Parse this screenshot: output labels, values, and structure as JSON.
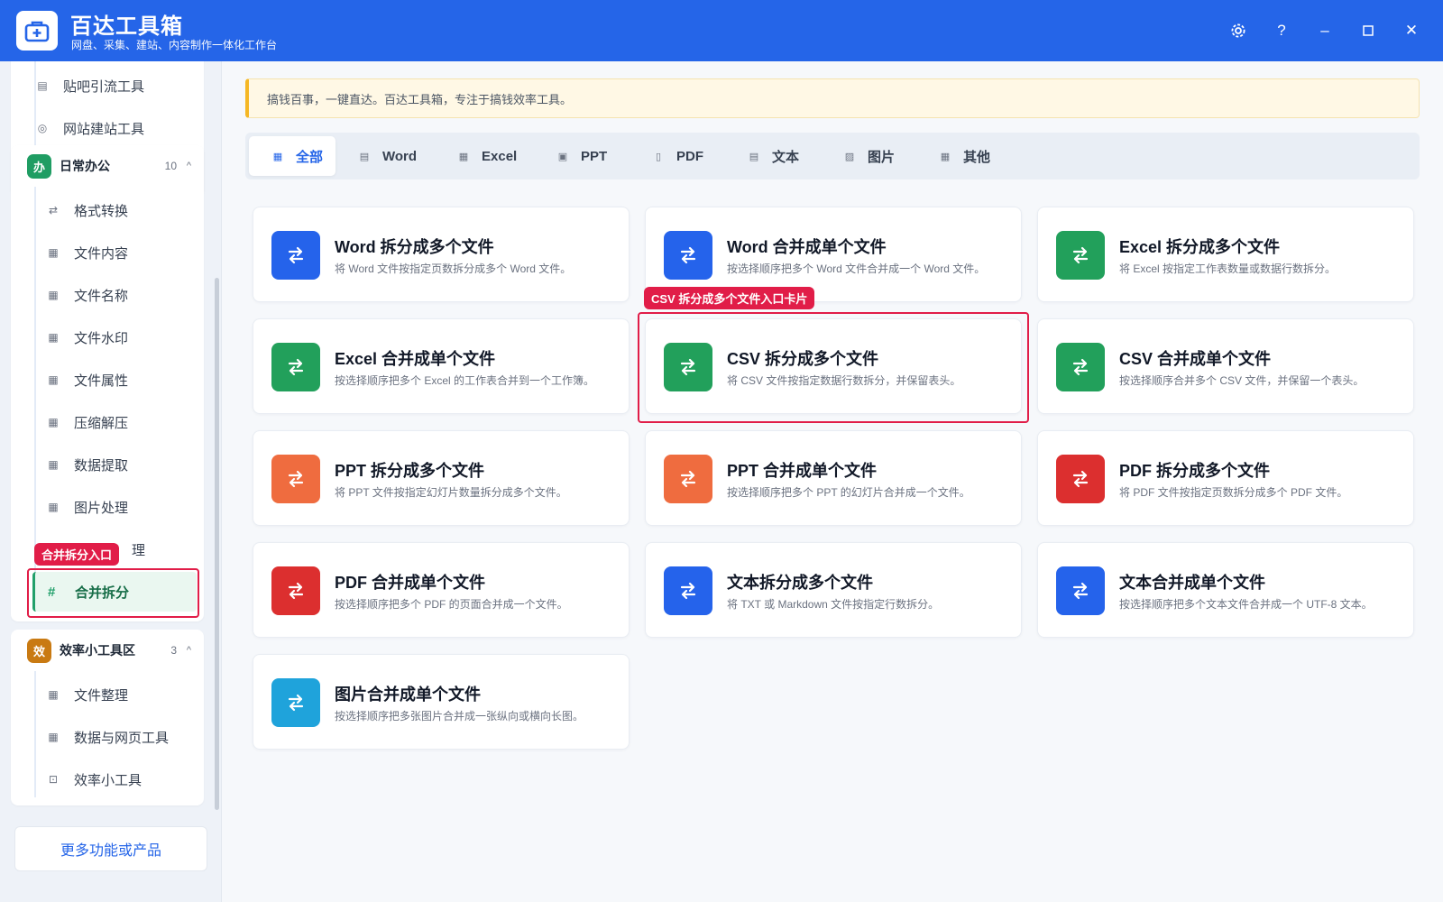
{
  "app": {
    "title": "百达工具箱",
    "subtitle": "网盘、采集、建站、内容制作一体化工作台",
    "logo_icon": "toolbox-icon"
  },
  "window_controls": {
    "settings": "⚙",
    "help": "?",
    "minimize": "–",
    "maximize": "□",
    "close": "✕"
  },
  "sidebar": {
    "top_items": [
      {
        "label": "贴吧引流工具",
        "icon": "list-icon"
      },
      {
        "label": "网站建站工具",
        "icon": "globe-icon"
      }
    ],
    "groups": [
      {
        "badge": "办",
        "title": "日常办公",
        "count": "10",
        "badge_color": "#1f9d63",
        "items": [
          {
            "label": "格式转换",
            "icon": "swap-icon"
          },
          {
            "label": "文件内容",
            "icon": "grid-icon"
          },
          {
            "label": "文件名称",
            "icon": "grid-icon"
          },
          {
            "label": "文件水印",
            "icon": "grid-icon"
          },
          {
            "label": "文件属性",
            "icon": "grid-icon"
          },
          {
            "label": "压缩解压",
            "icon": "grid-icon"
          },
          {
            "label": "数据提取",
            "icon": "grid-icon"
          },
          {
            "label": "图片处理",
            "icon": "grid-icon"
          },
          {
            "label": "理",
            "icon": "grid-icon"
          }
        ],
        "active_item": {
          "label": "合并拆分",
          "icon": "hash-icon"
        }
      },
      {
        "badge": "效",
        "title": "效率小工具区",
        "count": "3",
        "badge_color": "#c97a12",
        "items": [
          {
            "label": "文件整理",
            "icon": "grid-icon"
          },
          {
            "label": "数据与网页工具",
            "icon": "grid-icon"
          },
          {
            "label": "效率小工具",
            "icon": "toolbox-icon"
          }
        ]
      }
    ],
    "more_button": "更多功能或产品",
    "highlight_tag": "合并拆分入口"
  },
  "notice": "搞钱百事，一键直达。百达工具箱，专注于搞钱效率工具。",
  "tabs": [
    {
      "label": "全部",
      "icon": "grid-icon",
      "active": true
    },
    {
      "label": "Word",
      "icon": "doc-icon"
    },
    {
      "label": "Excel",
      "icon": "table-icon"
    },
    {
      "label": "PPT",
      "icon": "slides-icon"
    },
    {
      "label": "PDF",
      "icon": "file-icon"
    },
    {
      "label": "文本",
      "icon": "text-icon"
    },
    {
      "label": "图片",
      "icon": "image-icon"
    },
    {
      "label": "其他",
      "icon": "grid-icon"
    }
  ],
  "cards": [
    {
      "title": "Word 拆分成多个文件",
      "desc": "将 Word 文件按指定页数拆分成多个 Word 文件。",
      "color": "#2563eb"
    },
    {
      "title": "Word 合并成单个文件",
      "desc": "按选择顺序把多个 Word 文件合并成一个 Word 文件。",
      "color": "#2563eb"
    },
    {
      "title": "Excel 拆分成多个文件",
      "desc": "将 Excel 按指定工作表数量或数据行数拆分。",
      "color": "#22a05b"
    },
    {
      "title": "Excel 合并成单个文件",
      "desc": "按选择顺序把多个 Excel 的工作表合并到一个工作簿。",
      "color": "#22a05b"
    },
    {
      "title": "CSV 拆分成多个文件",
      "desc": "将 CSV 文件按指定数据行数拆分，并保留表头。",
      "color": "#22a05b"
    },
    {
      "title": "CSV 合并成单个文件",
      "desc": "按选择顺序合并多个 CSV 文件，并保留一个表头。",
      "color": "#22a05b"
    },
    {
      "title": "PPT 拆分成多个文件",
      "desc": "将 PPT 文件按指定幻灯片数量拆分成多个文件。",
      "color": "#ef6c3f"
    },
    {
      "title": "PPT 合并成单个文件",
      "desc": "按选择顺序把多个 PPT 的幻灯片合并成一个文件。",
      "color": "#ef6c3f"
    },
    {
      "title": "PDF 拆分成多个文件",
      "desc": "将 PDF 文件按指定页数拆分成多个 PDF 文件。",
      "color": "#dc2f2f"
    },
    {
      "title": "PDF 合并成单个文件",
      "desc": "按选择顺序把多个 PDF 的页面合并成一个文件。",
      "color": "#dc2f2f"
    },
    {
      "title": "文本拆分成多个文件",
      "desc": "将 TXT 或 Markdown 文件按指定行数拆分。",
      "color": "#2563eb"
    },
    {
      "title": "文本合并成单个文件",
      "desc": "按选择顺序把多个文本文件合并成一个 UTF-8 文本。",
      "color": "#2563eb"
    },
    {
      "title": "图片合并成单个文件",
      "desc": "按选择顺序把多张图片合并成一张纵向或横向长图。",
      "color": "#1fa3db"
    }
  ],
  "card_highlight_tag": "CSV 拆分成多个文件入口卡片"
}
